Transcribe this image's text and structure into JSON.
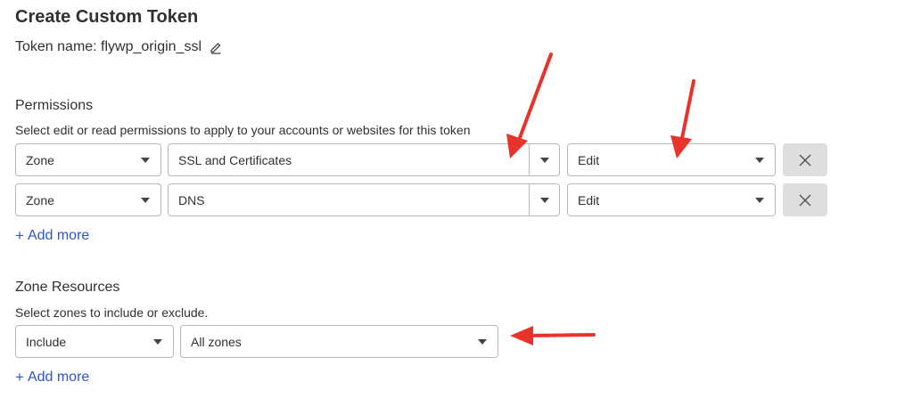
{
  "page": {
    "title": "Create Custom Token",
    "token_name_label": "Token name: flywp_origin_ssl",
    "edit_icon": "pencil-icon"
  },
  "permissions": {
    "title": "Permissions",
    "description": "Select edit or read permissions to apply to your accounts or websites for this token",
    "rows": [
      {
        "scope": "Zone",
        "permission": "SSL and Certificates",
        "access": "Edit",
        "remove_icon": "close-icon"
      },
      {
        "scope": "Zone",
        "permission": "DNS",
        "access": "Edit",
        "remove_icon": "close-icon"
      }
    ],
    "add_more": "Add more"
  },
  "zone_resources": {
    "title": "Zone Resources",
    "description": "Select zones to include or exclude.",
    "rows": [
      {
        "mode": "Include",
        "zones": "All zones"
      }
    ],
    "add_more": "Add more"
  },
  "annotations": {
    "arrow_color": "#e8332a",
    "count": 3
  }
}
